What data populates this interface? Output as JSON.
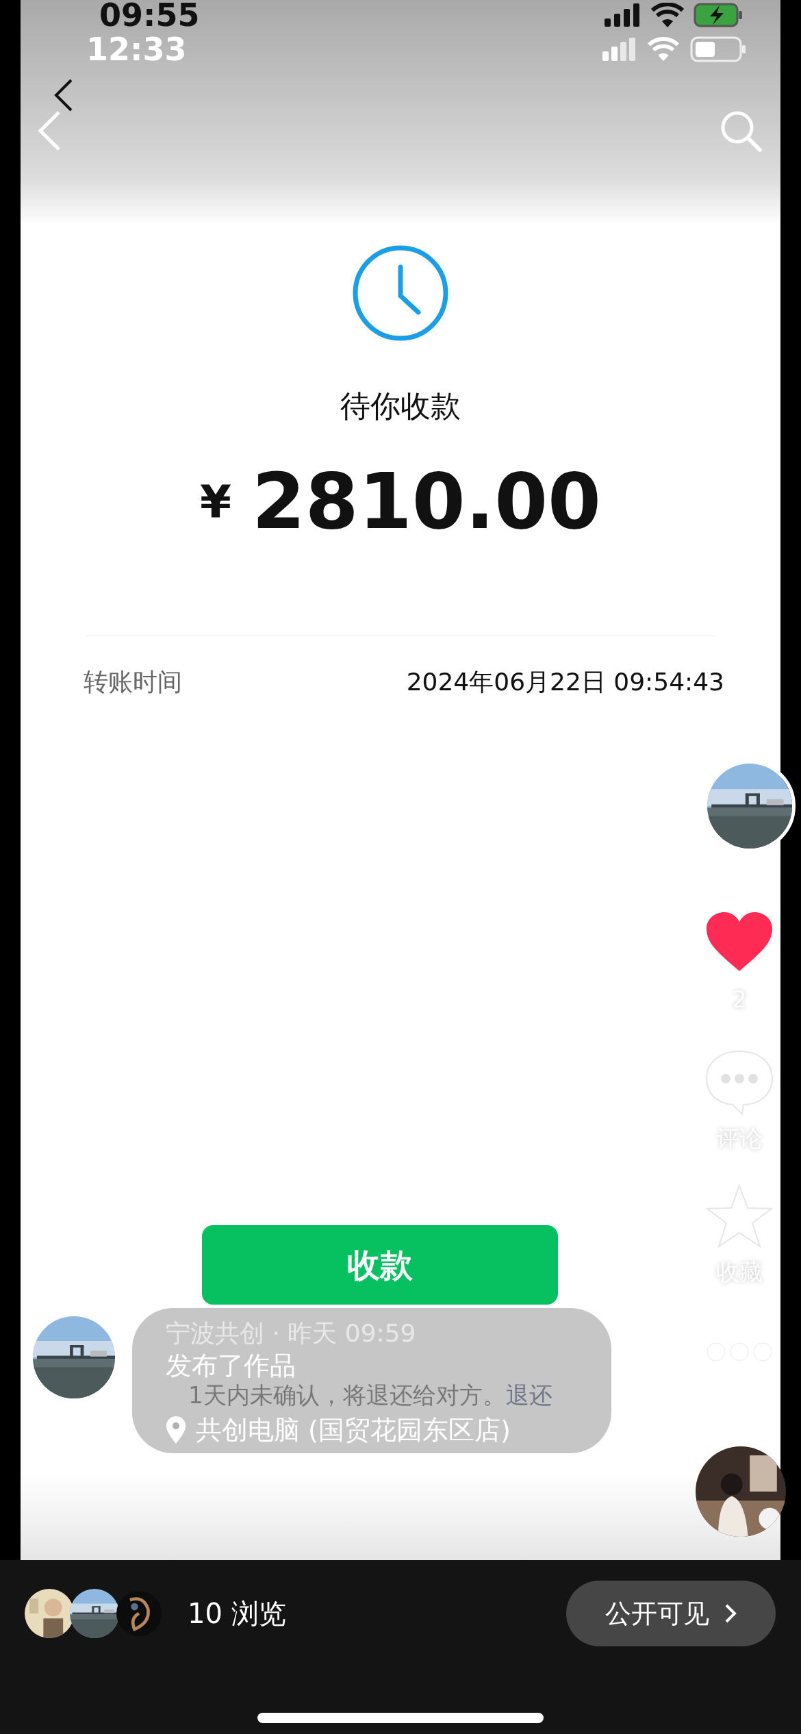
{
  "outer_status_bar": {
    "time": "09:55"
  },
  "inner_status_bar": {
    "time": "12:33"
  },
  "transfer": {
    "status": "待你收款",
    "currency": "¥",
    "amount": "2810.00",
    "time_label": "转账时间",
    "time_value": "2024年06月22日 09:54:43",
    "button": "收款",
    "notice": "1天内未确认，将退还给对方。",
    "notice_link": "退还"
  },
  "side_actions": {
    "liked": true,
    "likes": "2",
    "comment_label": "评论",
    "favorite_label": "收藏"
  },
  "post": {
    "byline": "宁波共创 · 昨天 09:59",
    "action": "发布了作品",
    "location": "共创电脑 (国贸花园东区店)"
  },
  "footer": {
    "views": "10 浏览",
    "visibility_button": "公开可见"
  }
}
